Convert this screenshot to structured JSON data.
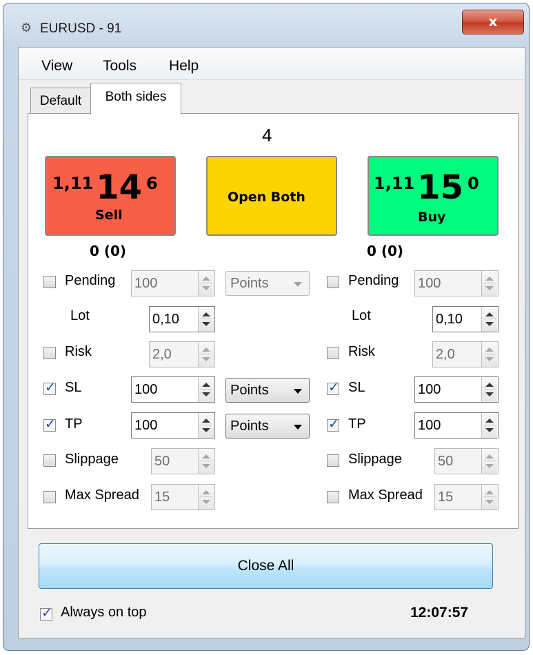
{
  "window": {
    "title": "EURUSD - 91",
    "close_glyph": "x"
  },
  "menu": [
    "View",
    "Tools",
    "Help"
  ],
  "tabs": [
    {
      "label": "Default",
      "active": false
    },
    {
      "label": "Both sides",
      "active": true
    }
  ],
  "order_count": "4",
  "sell": {
    "price_prefix": "1,11",
    "price_big": "14",
    "price_pip": "6",
    "label": "Sell",
    "color": "#f75f47",
    "positions": "0 (0)"
  },
  "open_both": {
    "label": "Open Both",
    "color": "#fed400"
  },
  "buy": {
    "price_prefix": "1,11",
    "price_big": "15",
    "price_pip": "0",
    "label": "Buy",
    "color": "#00fa7e",
    "positions": "0 (0)"
  },
  "left": {
    "pending": {
      "label": "Pending",
      "checked": false,
      "value": "100",
      "unit": "Points"
    },
    "lot": {
      "label": "Lot",
      "value": "0,10"
    },
    "risk": {
      "label": "Risk",
      "checked": false,
      "value": "2,0"
    },
    "sl": {
      "label": "SL",
      "checked": true,
      "value": "100",
      "unit": "Points"
    },
    "tp": {
      "label": "TP",
      "checked": true,
      "value": "100",
      "unit": "Points"
    },
    "slippage": {
      "label": "Slippage",
      "checked": false,
      "value": "50"
    },
    "max_spread": {
      "label": "Max Spread",
      "checked": false,
      "value": "15"
    }
  },
  "right": {
    "pending": {
      "label": "Pending",
      "checked": false,
      "value": "100"
    },
    "lot": {
      "label": "Lot",
      "value": "0,10"
    },
    "risk": {
      "label": "Risk",
      "checked": false,
      "value": "2,0"
    },
    "sl": {
      "label": "SL",
      "checked": true,
      "value": "100"
    },
    "tp": {
      "label": "TP",
      "checked": true,
      "value": "100"
    },
    "slippage": {
      "label": "Slippage",
      "checked": false,
      "value": "50"
    },
    "max_spread": {
      "label": "Max Spread",
      "checked": false,
      "value": "15"
    }
  },
  "close_all_label": "Close All",
  "always_on_top": {
    "label": "Always on top",
    "checked": true
  },
  "clock": "12:07:57"
}
